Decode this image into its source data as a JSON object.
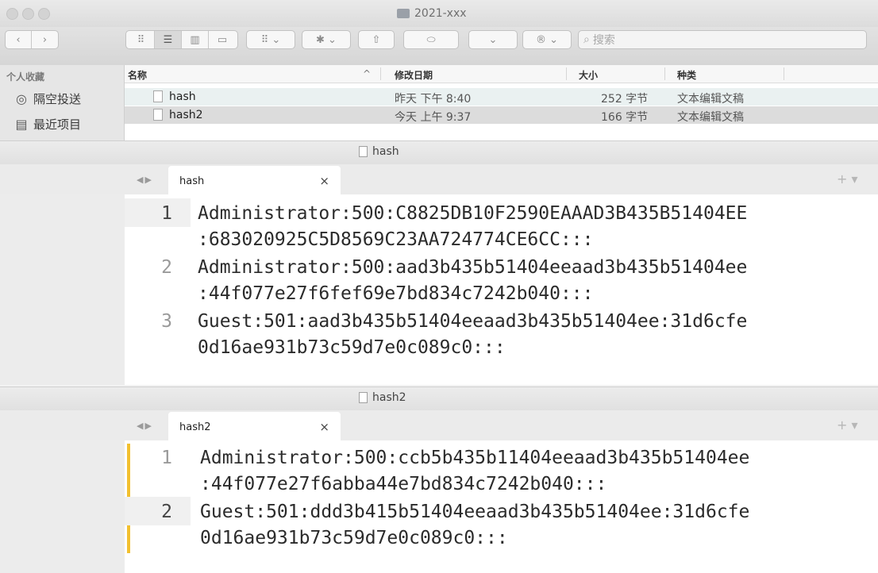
{
  "finder": {
    "title": "2021-xxx",
    "search_placeholder": "搜索",
    "sidebar": {
      "heading": "个人收藏",
      "items": [
        {
          "label": "隔空投送",
          "icon": "airdrop-icon"
        },
        {
          "label": "最近项目",
          "icon": "recents-icon"
        }
      ]
    },
    "columns": {
      "name": "名称",
      "date": "修改日期",
      "size": "大小",
      "kind": "种类"
    },
    "files": [
      {
        "name": "hash",
        "date": "昨天 下午 8:40",
        "size": "252 字节",
        "kind": "文本编辑文稿"
      },
      {
        "name": "hash2",
        "date": "今天 上午 9:37",
        "size": "166 字节",
        "kind": "文本编辑文稿"
      }
    ]
  },
  "editor1": {
    "window_title": "hash",
    "tab_label": "hash",
    "tab_close": "×",
    "lines": [
      {
        "num": "1",
        "text": "Administrator:500:C8825DB10F2590EAAAD3B435B51404EE",
        "cont": ":683020925C5D8569C23AA724774CE6CC:::"
      },
      {
        "num": "2",
        "text": "Administrator:500:aad3b435b51404eeaad3b435b51404ee",
        "cont": ":44f077e27f6fef69e7bd834c7242b040:::"
      },
      {
        "num": "3",
        "text": "Guest:501:aad3b435b51404eeaad3b435b51404ee:31d6cfe",
        "cont": "0d16ae931b73c59d7e0c089c0:::"
      }
    ]
  },
  "editor2": {
    "window_title": "hash2",
    "tab_label": "hash2",
    "tab_close": "×",
    "lines": [
      {
        "num": "1",
        "text": "Administrator:500:ccb5b435b11404eeaad3b435b51404ee",
        "cont": ":44f077e27f6abba44e7bd834c7242b040:::"
      },
      {
        "num": "2",
        "text": "Guest:501:ddd3b415b51404eeaad3b435b51404ee:31d6cfe",
        "cont": "0d16ae931b73c59d7e0c089c0:::"
      }
    ]
  },
  "colors": {
    "change_bar": "#f2c02f",
    "selected_row": "#dcdcdc",
    "highlight_row": "#eaf1f1"
  }
}
